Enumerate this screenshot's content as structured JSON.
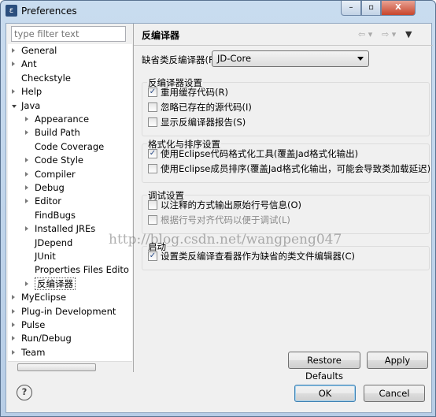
{
  "window": {
    "title": "Preferences",
    "app_icon": "eclipse-icon",
    "controls": [
      "minimize",
      "maximize",
      "close"
    ]
  },
  "filter": {
    "placeholder": "type filter text"
  },
  "tree": [
    {
      "label": "General",
      "level": 0,
      "expanded": false
    },
    {
      "label": "Ant",
      "level": 0,
      "expanded": false
    },
    {
      "label": "Checkstyle",
      "level": 0,
      "leaf": true
    },
    {
      "label": "Help",
      "level": 0,
      "expanded": false
    },
    {
      "label": "Java",
      "level": 0,
      "expanded": true
    },
    {
      "label": "Appearance",
      "level": 1,
      "expanded": false
    },
    {
      "label": "Build Path",
      "level": 1,
      "expanded": false
    },
    {
      "label": "Code Coverage",
      "level": 1,
      "leaf": true
    },
    {
      "label": "Code Style",
      "level": 1,
      "expanded": false
    },
    {
      "label": "Compiler",
      "level": 1,
      "expanded": false
    },
    {
      "label": "Debug",
      "level": 1,
      "expanded": false
    },
    {
      "label": "Editor",
      "level": 1,
      "expanded": false
    },
    {
      "label": "FindBugs",
      "level": 1,
      "leaf": true
    },
    {
      "label": "Installed JREs",
      "level": 1,
      "expanded": false
    },
    {
      "label": "JDepend",
      "level": 1,
      "leaf": true
    },
    {
      "label": "JUnit",
      "level": 1,
      "leaf": true
    },
    {
      "label": "Properties Files Edito",
      "level": 1,
      "leaf": true
    },
    {
      "label": "反编译器",
      "level": 1,
      "expanded": false,
      "selected": true
    },
    {
      "label": "MyEclipse",
      "level": 0,
      "expanded": false
    },
    {
      "label": "Plug-in Development",
      "level": 0,
      "expanded": false
    },
    {
      "label": "Pulse",
      "level": 0,
      "expanded": false
    },
    {
      "label": "Run/Debug",
      "level": 0,
      "expanded": false
    },
    {
      "label": "Team",
      "level": 0,
      "expanded": false
    }
  ],
  "page": {
    "title": "反编译器",
    "default_label": "缺省类反编译器(F)",
    "default_value": "JD-Core",
    "groups": [
      {
        "label": "反编译器设置",
        "options": [
          {
            "label": "重用缓存代码(R)",
            "checked": true
          },
          {
            "label": "忽略已存在的源代码(I)",
            "checked": false
          },
          {
            "label": "显示反编译器报告(S)",
            "checked": false
          }
        ]
      },
      {
        "label": "格式化与排序设置",
        "options": [
          {
            "label": "使用Eclipse代码格式化工具(覆盖Jad格式化输出)",
            "checked": true
          },
          {
            "label": "使用Eclipse成员排序(覆盖Jad格式化输出，可能会导致类加载延迟)",
            "checked": false
          }
        ]
      },
      {
        "label": "调试设置",
        "options": [
          {
            "label": "以注释的方式输出原始行号信息(O)",
            "checked": false
          },
          {
            "label": "根据行号对齐代码以便于调试(L)",
            "checked": false,
            "disabled": true
          }
        ]
      },
      {
        "label": "启动",
        "options": [
          {
            "label": "设置类反编译查看器作为缺省的类文件编辑器(C)",
            "checked": true
          }
        ]
      }
    ],
    "restore_defaults": "Restore Defaults",
    "apply": "Apply"
  },
  "footer": {
    "help": "?",
    "ok": "OK",
    "cancel": "Cancel"
  },
  "watermark": "http://blog.csdn.net/wangpeng047"
}
